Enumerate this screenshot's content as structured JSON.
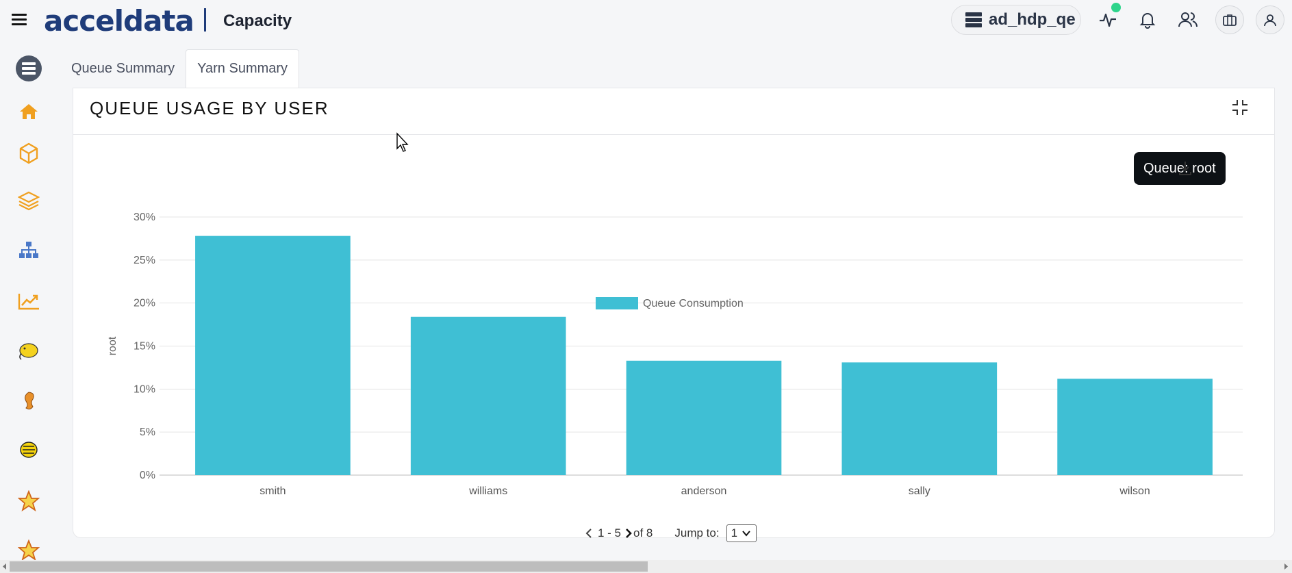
{
  "header": {
    "logo_text": "acceldata",
    "app_title": "Capacity",
    "cluster_name": "ad_hdp_qe"
  },
  "tabs": [
    {
      "label": "Queue Summary",
      "active": false
    },
    {
      "label": "Yarn Summary",
      "active": true
    }
  ],
  "card": {
    "title": "QUEUE USAGE BY USER",
    "queue_chip": "Queue: root"
  },
  "pager": {
    "range": "1 - 5",
    "total": "of 8",
    "jump_label": "Jump to:",
    "jump_value": "1"
  },
  "colors": {
    "bar": "#3fbfd4",
    "brand": "#1f3c7a",
    "sidebar_icon": "#f0a020",
    "status_dot": "#2ed48b"
  },
  "sidebar_icons": [
    "database-icon",
    "home-icon",
    "cube-icon",
    "layers-icon",
    "hierarchy-icon",
    "trend-chart-icon",
    "hadoop-elephant-icon",
    "seahorse-icon",
    "hive-bee-icon",
    "star-icon",
    "star-icon"
  ],
  "chart_data": {
    "type": "bar",
    "categories": [
      "smith",
      "williams",
      "anderson",
      "sally",
      "wilson"
    ],
    "series": [
      {
        "name": "Queue Consumption",
        "values": [
          27.8,
          18.4,
          13.3,
          13.1,
          11.2
        ]
      }
    ],
    "ylabel": "root",
    "xlabel": "",
    "ylim": [
      0,
      30
    ],
    "yticks": [
      "0%",
      "5%",
      "10%",
      "15%",
      "20%",
      "25%",
      "30%"
    ],
    "grid": true,
    "legend": "top-center"
  }
}
